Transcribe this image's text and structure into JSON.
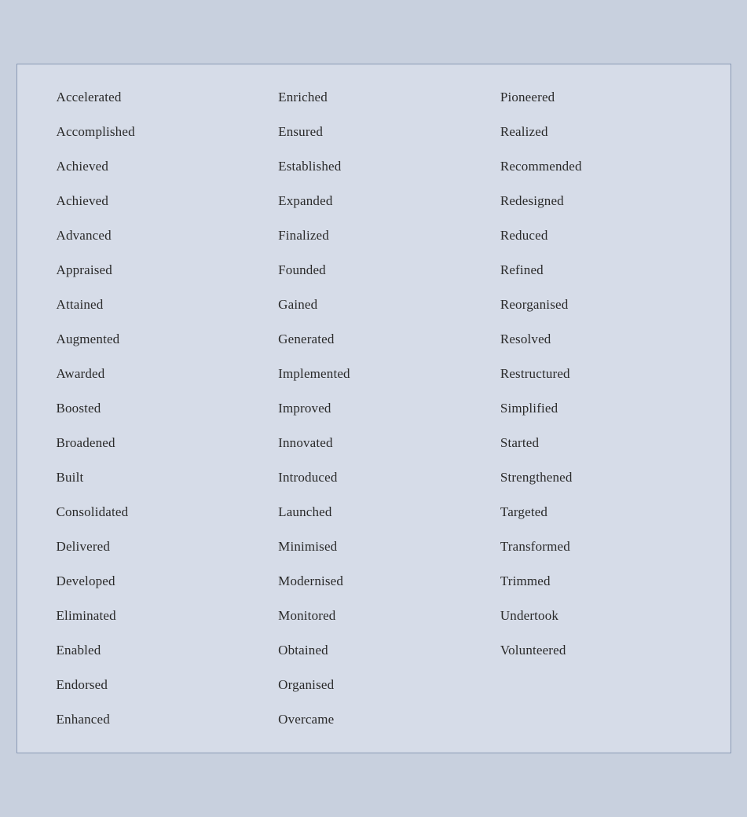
{
  "columns": [
    [
      "Accelerated",
      "Accomplished",
      "Achieved",
      "Achieved",
      "Advanced",
      "Appraised",
      "Attained",
      "Augmented",
      "Awarded",
      "Boosted",
      "Broadened",
      "Built",
      "Consolidated",
      "Delivered",
      "Developed",
      "Eliminated",
      "Enabled",
      "Endorsed",
      "Enhanced"
    ],
    [
      "Enriched",
      "Ensured",
      "Established",
      "Expanded",
      "Finalized",
      "Founded",
      "Gained",
      "Generated",
      "Implemented",
      "Improved",
      "Innovated",
      "Introduced",
      "Launched",
      "Minimised",
      "Modernised",
      "Monitored",
      "Obtained",
      "Organised",
      "Overcame"
    ],
    [
      "Pioneered",
      "Realized",
      "Recommended",
      "Redesigned",
      "Reduced",
      "Refined",
      "Reorganised",
      "Resolved",
      "Restructured",
      "Simplified",
      "Started",
      "Strengthened",
      "Targeted",
      "Transformed",
      "Trimmed",
      "Undertook",
      "Volunteered",
      "",
      ""
    ]
  ]
}
